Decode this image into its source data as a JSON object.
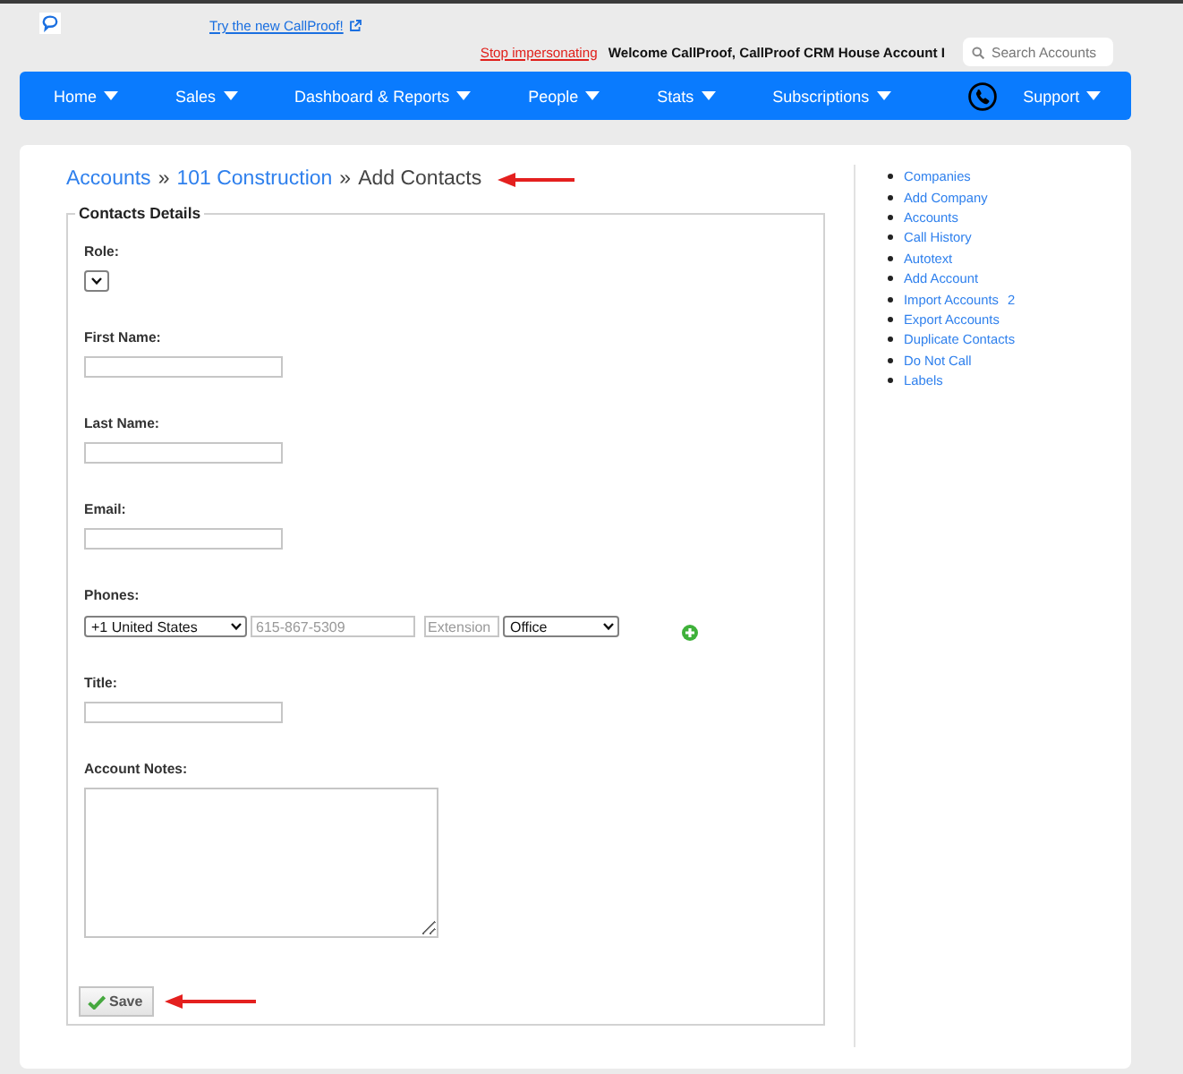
{
  "header": {
    "try_link": "Try the new CallProof!",
    "stop_link": "Stop impersonating",
    "welcome": "Welcome CallProof, CallProof CRM House Account I",
    "search": {
      "placeholder": "Search Accounts"
    }
  },
  "nav": {
    "items": [
      {
        "kind": "menu",
        "label": "Home"
      },
      {
        "kind": "menu",
        "label": "Sales"
      },
      {
        "kind": "menu",
        "label": "Dashboard & Reports"
      },
      {
        "kind": "menu",
        "label": "People"
      },
      {
        "kind": "menu",
        "label": "Stats"
      },
      {
        "kind": "menu",
        "label": "Subscriptions"
      },
      {
        "kind": "phone"
      },
      {
        "kind": "menu",
        "label": "Support"
      }
    ]
  },
  "breadcrumb": [
    {
      "kind": "link",
      "label": "Accounts"
    },
    {
      "kind": "separator",
      "label": "»"
    },
    {
      "kind": "link",
      "label": "101 Construction"
    },
    {
      "kind": "separator",
      "label": "»"
    },
    {
      "kind": "current",
      "label": "Add Contacts"
    }
  ],
  "form": {
    "legend": "Contacts Details",
    "fields": [
      {
        "kind": "select",
        "label": "Role:"
      },
      {
        "kind": "text",
        "label": "First Name:"
      },
      {
        "kind": "text",
        "label": "Last Name:"
      },
      {
        "kind": "text",
        "label": "Email:"
      },
      {
        "kind": "phone",
        "label": "Phones:",
        "country": "+1 United States",
        "number": {
          "placeholder": "615-867-5309"
        },
        "extension": {
          "placeholder": "Extension"
        },
        "phone_type": "Office"
      },
      {
        "kind": "text",
        "label": "Title:"
      },
      {
        "kind": "textarea",
        "label": "Account Notes:"
      }
    ],
    "save_button": "Save"
  },
  "sidebar": {
    "items": [
      {
        "label": "Companies"
      },
      {
        "label": "Add Company"
      },
      {
        "label": "Accounts"
      },
      {
        "label": "Call History"
      },
      {
        "label": "Autotext"
      },
      {
        "label": "Add Account"
      },
      {
        "label": "Import Accounts",
        "count": "2"
      },
      {
        "label": "Export Accounts"
      },
      {
        "label": "Duplicate Contacts"
      },
      {
        "label": "Do Not Call"
      },
      {
        "label": "Labels"
      }
    ]
  }
}
